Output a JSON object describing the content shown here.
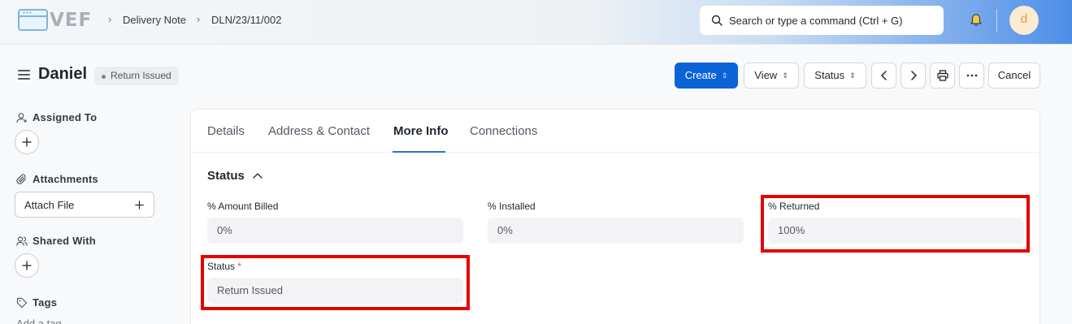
{
  "navbar": {
    "logo_text": "VEF",
    "breadcrumbs": [
      "Delivery Note",
      "DLN/23/11/002"
    ],
    "search_placeholder": "Search or type a command (Ctrl + G)",
    "avatar_initial": "d",
    "gradient_accent": "#4d8ee8"
  },
  "page": {
    "title": "Daniel",
    "status_badge": "Return Issued",
    "buttons": {
      "create": "Create",
      "view": "View",
      "status": "Status",
      "cancel": "Cancel"
    },
    "icons": [
      "menu-icon",
      "chevron-left-icon",
      "chevron-right-icon",
      "printer-icon",
      "more-icon"
    ]
  },
  "sidebar": {
    "assigned_to": "Assigned To",
    "attachments": "Attachments",
    "attach_file": "Attach File",
    "shared_with": "Shared With",
    "tags": "Tags",
    "add_tag": "Add a tag"
  },
  "form": {
    "tabs": [
      "Details",
      "Address & Contact",
      "More Info",
      "Connections"
    ],
    "active_tab": "More Info",
    "section_title": "Status",
    "fields": {
      "amount_billed": {
        "label": "% Amount Billed",
        "value": "0%"
      },
      "installed": {
        "label": "% Installed",
        "value": "0%"
      },
      "returned": {
        "label": "% Returned",
        "value": "100%"
      },
      "status": {
        "label": "Status",
        "required_mark": "*",
        "value": "Return Issued"
      }
    },
    "highlight_color": "#e60000",
    "primary_color": "#0b63d8"
  }
}
